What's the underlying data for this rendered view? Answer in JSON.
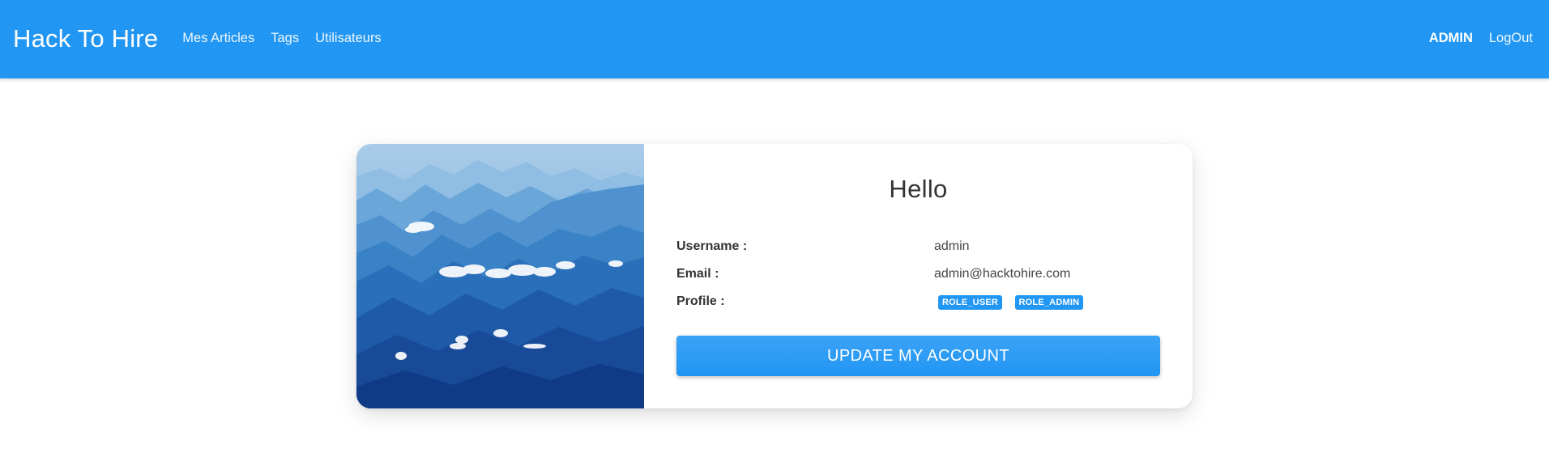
{
  "navbar": {
    "brand": "Hack To Hire",
    "links": [
      "Mes Articles",
      "Tags",
      "Utilisateurs"
    ],
    "user": "ADMIN",
    "logout": "LogOut",
    "background_color": "#2196f3"
  },
  "profile_card": {
    "greeting": "Hello",
    "image_icon": "mountain-landscape-image",
    "fields": {
      "username_label": "Username :",
      "username_value": "admin",
      "email_label": "Email :",
      "email_value": "admin@hacktohire.com",
      "profile_label": "Profile :"
    },
    "roles": [
      "ROLE_USER",
      "ROLE_ADMIN"
    ],
    "update_button": "Update my account",
    "accent_color": "#2196f3"
  }
}
